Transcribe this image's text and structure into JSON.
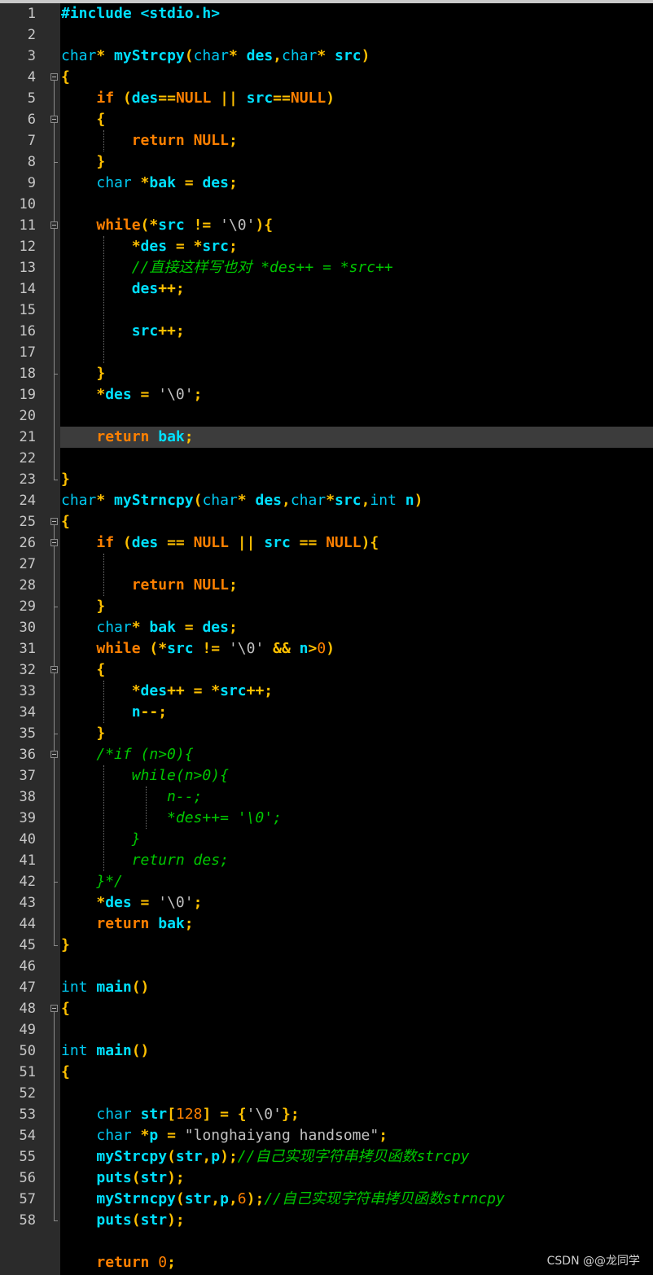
{
  "editor": {
    "watermark": "CSDN @@龙同学",
    "line_numbers": [
      "1",
      "2",
      "3",
      "4",
      "5",
      "6",
      "7",
      "8",
      "9",
      "10",
      "11",
      "12",
      "13",
      "14",
      "15",
      "16",
      "17",
      "18",
      "19",
      "20",
      "21",
      "22",
      "23",
      "24",
      "25",
      "26",
      "27",
      "28",
      "29",
      "30",
      "31",
      "32",
      "33",
      "34",
      "35",
      "36",
      "37",
      "38",
      "39",
      "40",
      "41",
      "42",
      "43",
      "44",
      "45",
      "46",
      "47",
      "48",
      "49",
      "50",
      "51",
      "52",
      "53",
      "54",
      "55",
      "56",
      "57",
      "58"
    ],
    "highlighted_line": 21,
    "lines": [
      [
        [
          "#include <stdio.h>",
          "pp"
        ]
      ],
      [],
      [
        [
          "char",
          "ty"
        ],
        [
          "* ",
          "op"
        ],
        [
          "myStrcpy",
          "id"
        ],
        [
          "(",
          "op"
        ],
        [
          "char",
          "ty"
        ],
        [
          "* ",
          "op"
        ],
        [
          "des",
          "id"
        ],
        [
          ",",
          "op"
        ],
        [
          "char",
          "ty"
        ],
        [
          "* ",
          "op"
        ],
        [
          "src",
          "id"
        ],
        [
          ")",
          "op"
        ]
      ],
      [
        [
          "{",
          "op"
        ]
      ],
      [
        [
          "    ",
          ""
        ],
        [
          "if",
          "kw"
        ],
        [
          " (",
          "op"
        ],
        [
          "des",
          "id"
        ],
        [
          "==",
          "op"
        ],
        [
          "NULL",
          "kw"
        ],
        [
          " || ",
          "op"
        ],
        [
          "src",
          "id"
        ],
        [
          "==",
          "op"
        ],
        [
          "NULL",
          "kw"
        ],
        [
          ")",
          "op"
        ]
      ],
      [
        [
          "    ",
          ""
        ],
        [
          "{",
          "op"
        ]
      ],
      [
        [
          "        ",
          ""
        ],
        [
          "return",
          "kw"
        ],
        [
          " ",
          ""
        ],
        [
          "NULL",
          "kw"
        ],
        [
          ";",
          "op"
        ]
      ],
      [
        [
          "    ",
          ""
        ],
        [
          "}",
          "op"
        ]
      ],
      [
        [
          "    ",
          ""
        ],
        [
          "char",
          "ty"
        ],
        [
          " *",
          "op"
        ],
        [
          "bak",
          "id"
        ],
        [
          " = ",
          "op"
        ],
        [
          "des",
          "id"
        ],
        [
          ";",
          "op"
        ]
      ],
      [],
      [
        [
          "    ",
          ""
        ],
        [
          "while",
          "kw"
        ],
        [
          "(*",
          "op"
        ],
        [
          "src",
          "id"
        ],
        [
          " != ",
          "op"
        ],
        [
          "'\\0'",
          "st"
        ],
        [
          "){",
          "op"
        ]
      ],
      [
        [
          "        ",
          ""
        ],
        [
          "*",
          "op"
        ],
        [
          "des",
          "id"
        ],
        [
          " = *",
          "op"
        ],
        [
          "src",
          "id"
        ],
        [
          ";",
          "op"
        ]
      ],
      [
        [
          "        ",
          ""
        ],
        [
          "//直接这样写也对 *des++ = *src++",
          "cm"
        ]
      ],
      [
        [
          "        ",
          ""
        ],
        [
          "des",
          "id"
        ],
        [
          "++;",
          "op"
        ]
      ],
      [],
      [
        [
          "        ",
          ""
        ],
        [
          "src",
          "id"
        ],
        [
          "++;",
          "op"
        ]
      ],
      [],
      [
        [
          "    ",
          ""
        ],
        [
          "}",
          "op"
        ]
      ],
      [
        [
          "    ",
          ""
        ],
        [
          "*",
          "op"
        ],
        [
          "des",
          "id"
        ],
        [
          " = ",
          "op"
        ],
        [
          "'\\0'",
          "st"
        ],
        [
          ";",
          "op"
        ]
      ],
      [],
      [
        [
          "    ",
          ""
        ],
        [
          "return",
          "kw"
        ],
        [
          " ",
          ""
        ],
        [
          "bak",
          "id"
        ],
        [
          ";",
          "op"
        ]
      ],
      [],
      [
        [
          "}",
          "op"
        ]
      ],
      [
        [
          "char",
          "ty"
        ],
        [
          "* ",
          "op"
        ],
        [
          "myStrncpy",
          "id"
        ],
        [
          "(",
          "op"
        ],
        [
          "char",
          "ty"
        ],
        [
          "* ",
          "op"
        ],
        [
          "des",
          "id"
        ],
        [
          ",",
          "op"
        ],
        [
          "char",
          "ty"
        ],
        [
          "*",
          "op"
        ],
        [
          "src",
          "id"
        ],
        [
          ",",
          "op"
        ],
        [
          "int",
          "ty"
        ],
        [
          " ",
          ""
        ],
        [
          "n",
          "id"
        ],
        [
          ")",
          "op"
        ]
      ],
      [
        [
          "{",
          "op"
        ]
      ],
      [
        [
          "    ",
          ""
        ],
        [
          "if",
          "kw"
        ],
        [
          " (",
          "op"
        ],
        [
          "des",
          "id"
        ],
        [
          " == ",
          "op"
        ],
        [
          "NULL",
          "kw"
        ],
        [
          " || ",
          "op"
        ],
        [
          "src",
          "id"
        ],
        [
          " == ",
          "op"
        ],
        [
          "NULL",
          "kw"
        ],
        [
          "){",
          "op"
        ]
      ],
      [],
      [
        [
          "        ",
          ""
        ],
        [
          "return",
          "kw"
        ],
        [
          " ",
          ""
        ],
        [
          "NULL",
          "kw"
        ],
        [
          ";",
          "op"
        ]
      ],
      [
        [
          "    ",
          ""
        ],
        [
          "}",
          "op"
        ]
      ],
      [
        [
          "    ",
          ""
        ],
        [
          "char",
          "ty"
        ],
        [
          "* ",
          "op"
        ],
        [
          "bak",
          "id"
        ],
        [
          " = ",
          "op"
        ],
        [
          "des",
          "id"
        ],
        [
          ";",
          "op"
        ]
      ],
      [
        [
          "    ",
          ""
        ],
        [
          "while",
          "kw"
        ],
        [
          " (*",
          "op"
        ],
        [
          "src",
          "id"
        ],
        [
          " != ",
          "op"
        ],
        [
          "'\\0'",
          "st"
        ],
        [
          " && ",
          "op"
        ],
        [
          "n",
          "id"
        ],
        [
          ">",
          "op"
        ],
        [
          "0",
          "nu"
        ],
        [
          ")",
          "op"
        ]
      ],
      [
        [
          "    ",
          ""
        ],
        [
          "{",
          "op"
        ]
      ],
      [
        [
          "        ",
          ""
        ],
        [
          "*",
          "op"
        ],
        [
          "des",
          "id"
        ],
        [
          "++ = *",
          "op"
        ],
        [
          "src",
          "id"
        ],
        [
          "++;",
          "op"
        ]
      ],
      [
        [
          "        ",
          ""
        ],
        [
          "n",
          "id"
        ],
        [
          "--;",
          "op"
        ]
      ],
      [
        [
          "    ",
          ""
        ],
        [
          "}",
          "op"
        ]
      ],
      [
        [
          "    ",
          ""
        ],
        [
          "/*if (n>0){",
          "cm"
        ]
      ],
      [
        [
          "        ",
          ""
        ],
        [
          "while(n>0){",
          "cm"
        ]
      ],
      [
        [
          "            ",
          ""
        ],
        [
          "n--;",
          "cm"
        ]
      ],
      [
        [
          "            ",
          ""
        ],
        [
          "*des++= '\\0';",
          "cm"
        ]
      ],
      [
        [
          "        ",
          ""
        ],
        [
          "}",
          "cm"
        ]
      ],
      [
        [
          "        ",
          ""
        ],
        [
          "return des;",
          "cm"
        ]
      ],
      [
        [
          "    ",
          ""
        ],
        [
          "}*/",
          "cm"
        ]
      ],
      [
        [
          "    ",
          ""
        ],
        [
          "*",
          "op"
        ],
        [
          "des",
          "id"
        ],
        [
          " = ",
          "op"
        ],
        [
          "'\\0'",
          "st"
        ],
        [
          ";",
          "op"
        ]
      ],
      [
        [
          "    ",
          ""
        ],
        [
          "return",
          "kw"
        ],
        [
          " ",
          ""
        ],
        [
          "bak",
          "id"
        ],
        [
          ";",
          "op"
        ]
      ],
      [
        [
          "}",
          "op"
        ]
      ],
      [],
      [
        [
          "int",
          "ty"
        ],
        [
          " ",
          ""
        ],
        [
          "main",
          "id"
        ],
        [
          "()",
          "op"
        ]
      ],
      [
        [
          "{",
          "op"
        ]
      ],
      [],
      [
        [
          "int",
          "ty"
        ],
        [
          " ",
          ""
        ],
        [
          "main",
          "id"
        ],
        [
          "()",
          "op"
        ]
      ],
      [
        [
          "{",
          "op"
        ]
      ],
      [],
      [
        [
          "    ",
          ""
        ],
        [
          "char",
          "ty"
        ],
        [
          " ",
          ""
        ],
        [
          "str",
          "id"
        ],
        [
          "[",
          "op"
        ],
        [
          "128",
          "nu"
        ],
        [
          "] = {",
          "op"
        ],
        [
          "'\\0'",
          "st"
        ],
        [
          "};",
          "op"
        ]
      ],
      [
        [
          "    ",
          ""
        ],
        [
          "char",
          "ty"
        ],
        [
          " *",
          "op"
        ],
        [
          "p",
          "id"
        ],
        [
          " = ",
          "op"
        ],
        [
          "\"longhaiyang handsome\"",
          "st"
        ],
        [
          ";",
          "op"
        ]
      ],
      [
        [
          "    ",
          ""
        ],
        [
          "myStrcpy",
          "id"
        ],
        [
          "(",
          "op"
        ],
        [
          "str",
          "id"
        ],
        [
          ",",
          "op"
        ],
        [
          "p",
          "id"
        ],
        [
          ");",
          "op"
        ],
        [
          "//自己实现字符串拷贝函数strcpy",
          "cm"
        ]
      ],
      [
        [
          "    ",
          ""
        ],
        [
          "puts",
          "id"
        ],
        [
          "(",
          "op"
        ],
        [
          "str",
          "id"
        ],
        [
          ");",
          "op"
        ]
      ],
      [
        [
          "    ",
          ""
        ],
        [
          "myStrncpy",
          "id"
        ],
        [
          "(",
          "op"
        ],
        [
          "str",
          "id"
        ],
        [
          ",",
          "op"
        ],
        [
          "p",
          "id"
        ],
        [
          ",",
          "op"
        ],
        [
          "6",
          "nu"
        ],
        [
          ");",
          "op"
        ],
        [
          "//自己实现字符串拷贝函数strncpy",
          "cm"
        ]
      ],
      [
        [
          "    ",
          ""
        ],
        [
          "puts",
          "id"
        ],
        [
          "(",
          "op"
        ],
        [
          "str",
          "id"
        ],
        [
          ");",
          "op"
        ]
      ],
      [],
      [
        [
          "    ",
          ""
        ],
        [
          "return",
          "kw"
        ],
        [
          " ",
          ""
        ],
        [
          "0",
          "nu"
        ],
        [
          ";",
          "op"
        ]
      ]
    ]
  }
}
